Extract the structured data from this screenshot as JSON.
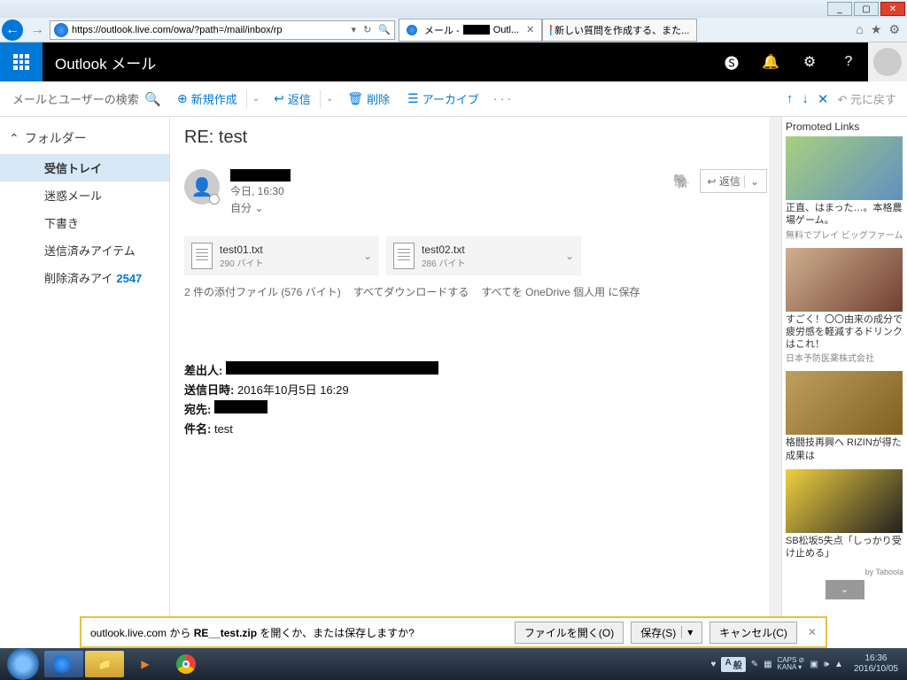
{
  "window": {
    "min": "_",
    "max": "▢",
    "close": "✕"
  },
  "ie": {
    "url": "https://outlook.live.com/owa/?path=/mail/inbox/rp",
    "tab1_prefix": "メール -",
    "tab1_suffix": "Outl...",
    "tab2": "新しい質問を作成する、また...",
    "refresh": "↻",
    "search": "🔍"
  },
  "header": {
    "brand": "Outlook メール",
    "icons": {
      "skype": "🅢",
      "bell": "🔔",
      "gear": "⚙",
      "help": "?"
    }
  },
  "toolbar": {
    "search_placeholder": "メールとユーザーの検索",
    "new": "新規作成",
    "reply": "返信",
    "delete": "削除",
    "archive": "アーカイブ",
    "more": "· · ·",
    "undo": "↶ 元に戻す"
  },
  "sidebar": {
    "folders_hdr": "フォルダー",
    "items": [
      {
        "label": "受信トレイ",
        "count": ""
      },
      {
        "label": "迷惑メール",
        "count": ""
      },
      {
        "label": "下書き",
        "count": ""
      },
      {
        "label": "送信済みアイテム",
        "count": ""
      },
      {
        "label": "削除済みアイ",
        "count": "2547"
      }
    ]
  },
  "message": {
    "subject": "RE: test",
    "date": "今日, 16:30",
    "to": "自分 ⌄",
    "reply_btn": "↩ 返信",
    "reply_chev": "⌄",
    "attachments": [
      {
        "name": "test01.txt",
        "size": "290 バイト"
      },
      {
        "name": "test02.txt",
        "size": "286 バイト"
      }
    ],
    "att_summary": "2 件の添付ファイル (576 バイト)",
    "att_download_all": "すべてダウンロードする",
    "att_save_onedrive": "すべてを OneDrive 個人用 に保存",
    "body": {
      "from_label": "差出人:",
      "sent_label": "送信日時:",
      "sent_value": "2016年10月5日 16:29",
      "to_label": "宛先:",
      "subject_label": "件名:",
      "subject_value": "test"
    }
  },
  "promoted": {
    "title": "Promoted Links",
    "cards": [
      {
        "txt": "正直、はまった…。本格農場ゲーム。",
        "sub": "無料でプレイ ビッグファーム"
      },
      {
        "txt": "すごく！〇〇由来の成分で疲労感を軽減するドリンクはこれ！",
        "sub": "日本予防医薬株式会社"
      },
      {
        "txt": "格闘技再興へ RIZINが得た成果は",
        "sub": ""
      },
      {
        "txt": "SB松坂5失点「しっかり受け止める」",
        "sub": ""
      }
    ],
    "by": "by Taboola"
  },
  "download": {
    "text_prefix": "outlook.live.com から ",
    "filename": "RE__test.zip",
    "text_suffix": " を開くか、または保存しますか?",
    "open": "ファイルを開く(O)",
    "save": "保存(S)",
    "cancel": "キャンセル(C)"
  },
  "taskbar": {
    "ime": [
      "A",
      "般"
    ],
    "caps": "CAPS",
    "kana": "KANA",
    "time": "16:36",
    "date": "2016/10/05"
  }
}
